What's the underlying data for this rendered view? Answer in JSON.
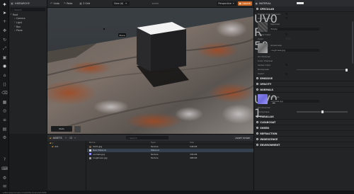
{
  "toolbar": {
    "icons": [
      "select-icon",
      "plus-icon",
      "move-icon",
      "rotate-icon",
      "scale-icon",
      "resize-icon",
      "globe-icon",
      "camera-icon",
      "code-icon",
      "trash-icon",
      "grid-icon",
      "physics-icon",
      "script-icon",
      "chart-icon",
      "settings-icon"
    ],
    "bottom_icons": [
      "help-icon",
      "controls-icon",
      "gear-icon",
      "chat-icon"
    ]
  },
  "hierarchy": {
    "title": "HIERARCHY",
    "search_placeholder": "Search",
    "root": "Root",
    "children": [
      "Camera",
      "Light",
      "Box",
      "Plane"
    ]
  },
  "viewport_bar": {
    "undo": "Undo",
    "redo": "Redo",
    "grid_label": "3 Grid",
    "view_label": "Persp",
    "view_name": "View (A)",
    "center": "scene",
    "mode": "Perspective",
    "launch": "Launch"
  },
  "viewport": {
    "tooltip": "Plane",
    "stats": "Stats"
  },
  "assets": {
    "title": "ASSETS",
    "search_placeholder": "Search",
    "upload": "ASSET STORE",
    "folders": [
      "/",
      "dirt"
    ],
    "columns": [
      "Name",
      "Type",
      "Size"
    ],
    "rows": [
      {
        "name": "dirtm.jpg",
        "type": "Texture",
        "size": "548 KB",
        "color": "#6a5a4a"
      },
      {
        "name": "New Material",
        "type": "Material",
        "size": "",
        "color": "#d8d8d8"
      },
      {
        "name": "normals.jpg",
        "type": "Texture",
        "size": "336 KB",
        "color": "#8a8aff"
      },
      {
        "name": "roughness.jpg",
        "type": "Texture",
        "size": "488 KB",
        "color": "#9a9a9a"
      }
    ]
  },
  "status": {
    "text": "editor.playcanvas.com/editor/scene/123456"
  },
  "inspector": {
    "title": "MATERIAL",
    "sections": {
      "specular": "SPECULAR",
      "emissive": "EMISSIVE",
      "opacity": "OPACITY",
      "normals": "NORMALS",
      "parallax": "PARALLAX",
      "clearcoat": "CLEARCOAT",
      "sheen": "SHEEN",
      "refraction": "REFRACTION",
      "iridescence": "IRIDESCENCE",
      "environment": "ENVIRONMENT"
    },
    "props": {
      "enable_gga": "Enable GGX Specular",
      "use_metalness": "Use Metalness",
      "specular": "Specular",
      "specular_file": "Empty",
      "vertex_color": "Vertex Color",
      "color": "Color",
      "glossiness": "Glossiness",
      "gloss_file": "roughness.jpg",
      "uv_channel": "UV Channel",
      "uv_value": "UV0",
      "color_channel": "Color Channel",
      "color_channel_value": "R",
      "vertex_color2": "Vertex Color",
      "glossiness_value": "Glossiness",
      "gloss_num": "50",
      "invert": "Invert",
      "normals_label": "Normals",
      "normals_file": "normals.jpg",
      "uv_channel2": "UV Channel",
      "uv_value2": "UV0",
      "bumpiness": "Bumpiness",
      "bump_num": "1"
    },
    "sliders": {
      "glossiness": 0.98,
      "bumpiness": 0.5
    }
  }
}
